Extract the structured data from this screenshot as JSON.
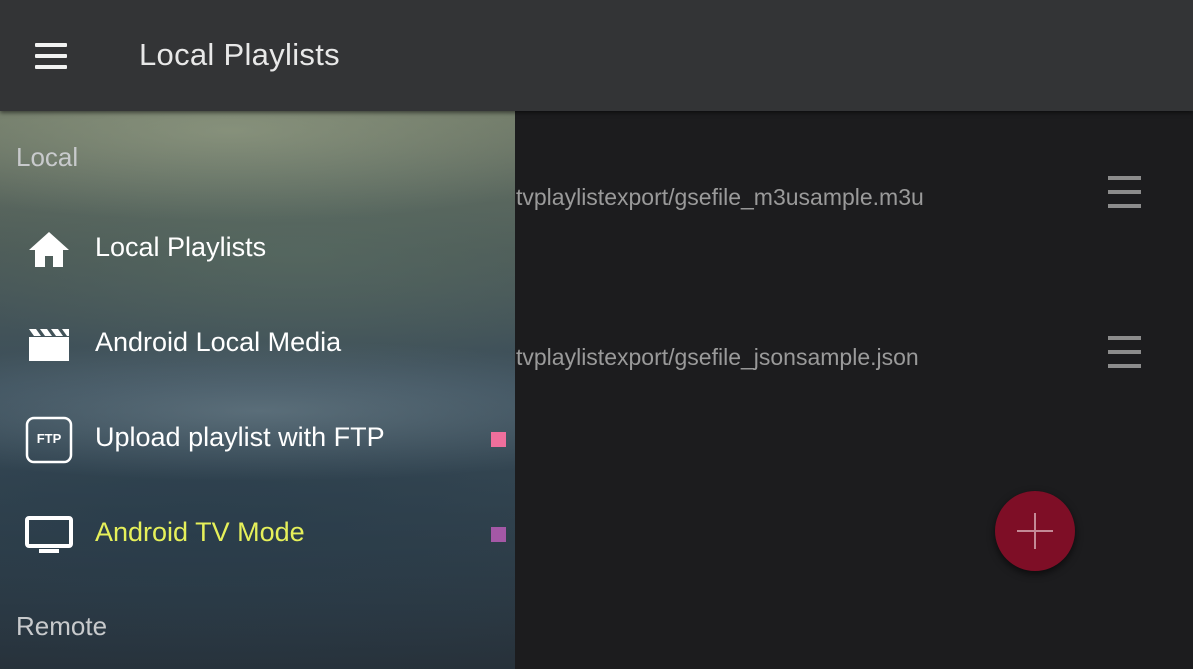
{
  "app_bar": {
    "title": "Local Playlists",
    "menu_icon": "hamburger-menu-icon"
  },
  "playlists": [
    {
      "path": "tvplaylistexport/gsefile_m3usample.m3u",
      "handle_icon": "drag-handle-icon"
    },
    {
      "path": "tvplaylistexport/gsefile_jsonsample.json",
      "handle_icon": "drag-handle-icon"
    }
  ],
  "fab": {
    "icon": "plus-icon",
    "color": "#7e0e26"
  },
  "drawer": {
    "local_header": "Local",
    "remote_header": "Remote",
    "items": [
      {
        "label": "Local Playlists",
        "icon": "home-icon",
        "active": false,
        "marker_color": null
      },
      {
        "label": "Android Local Media",
        "icon": "clapperboard-icon",
        "active": false,
        "marker_color": null
      },
      {
        "label": "Upload playlist with FTP",
        "icon": "ftp-icon",
        "icon_text": "FTP",
        "active": false,
        "marker_color": "#ef6f9c"
      },
      {
        "label": "Android TV Mode",
        "icon": "tv-icon",
        "active": true,
        "marker_color": "#a458a6"
      }
    ]
  },
  "colors": {
    "app_bar": "#333436",
    "content_bg": "#1c1c1e",
    "active_label": "#e6f05a"
  }
}
